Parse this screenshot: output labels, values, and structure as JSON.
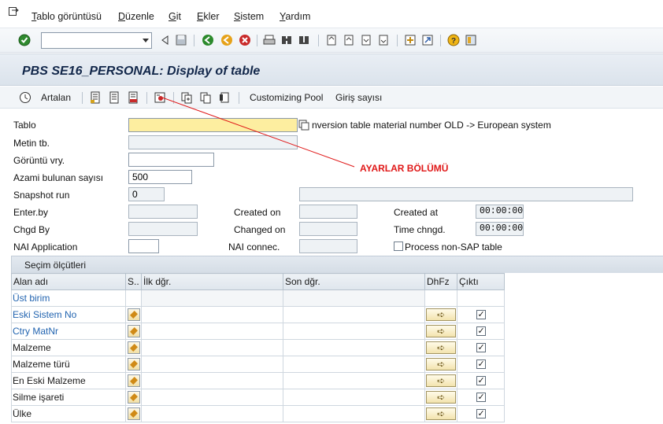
{
  "menu": {
    "items": [
      "Tablo görüntüsü",
      "Düzenle",
      "Git",
      "Ekler",
      "Sistem",
      "Yardım"
    ]
  },
  "system_toolbar": {
    "command_field": ""
  },
  "title": "PBS SE16_PERSONAL: Display of table",
  "app_toolbar": {
    "artalan_label": "Artalan",
    "customizing_pool_label": "Customizing Pool",
    "giris_sayisi_label": "Giriş sayısı"
  },
  "form": {
    "tablo_label": "Tablo",
    "tablo_value": "",
    "tablo_description": "nversion table material number OLD -> European system",
    "metin_label": "Metin tb.",
    "goruntu_label": "Görüntü vry.",
    "azami_label": "Azami bulunan sayısı",
    "azami_value": "500",
    "snapshot_label": "Snapshot run",
    "snapshot_value": "0",
    "enterby_label": "Enter.by",
    "createdon_label": "Created on",
    "createdat_label": "Created at",
    "createdat_value": "00:00:00",
    "chgdby_label": "Chgd By",
    "changedon_label": "Changed on",
    "timechngd_label": "Time chngd.",
    "timechngd_value": "00:00:00",
    "nai_app_label": "NAI Application",
    "nai_connec_label": "NAI connec.",
    "process_label": "Process non-SAP table"
  },
  "annotation": "AYARLAR BÖLÜMÜ",
  "selection": {
    "header": "Seçim ölçütleri",
    "columns": [
      "Alan adı",
      "S..",
      "İlk dğr.",
      "Son dğr.",
      "DhFz",
      "Çıktı"
    ],
    "rows": [
      {
        "name": "Üst birim",
        "link": true,
        "has_controls": false
      },
      {
        "name": "Eski Sistem No",
        "link": true,
        "has_controls": true
      },
      {
        "name": "Ctry MatNr",
        "link": true,
        "has_controls": true
      },
      {
        "name": "Malzeme",
        "link": false,
        "has_controls": true
      },
      {
        "name": "Malzeme türü",
        "link": false,
        "has_controls": true
      },
      {
        "name": "En Eski Malzeme",
        "link": false,
        "has_controls": true
      },
      {
        "name": "Silme işareti",
        "link": false,
        "has_controls": true
      },
      {
        "name": "Ülke",
        "link": false,
        "has_controls": true
      }
    ]
  },
  "colors": {
    "title_text": "#12274a",
    "annotation_red": "#e01818",
    "link_blue": "#2264b0",
    "required_yellow": "#fdeea0"
  }
}
